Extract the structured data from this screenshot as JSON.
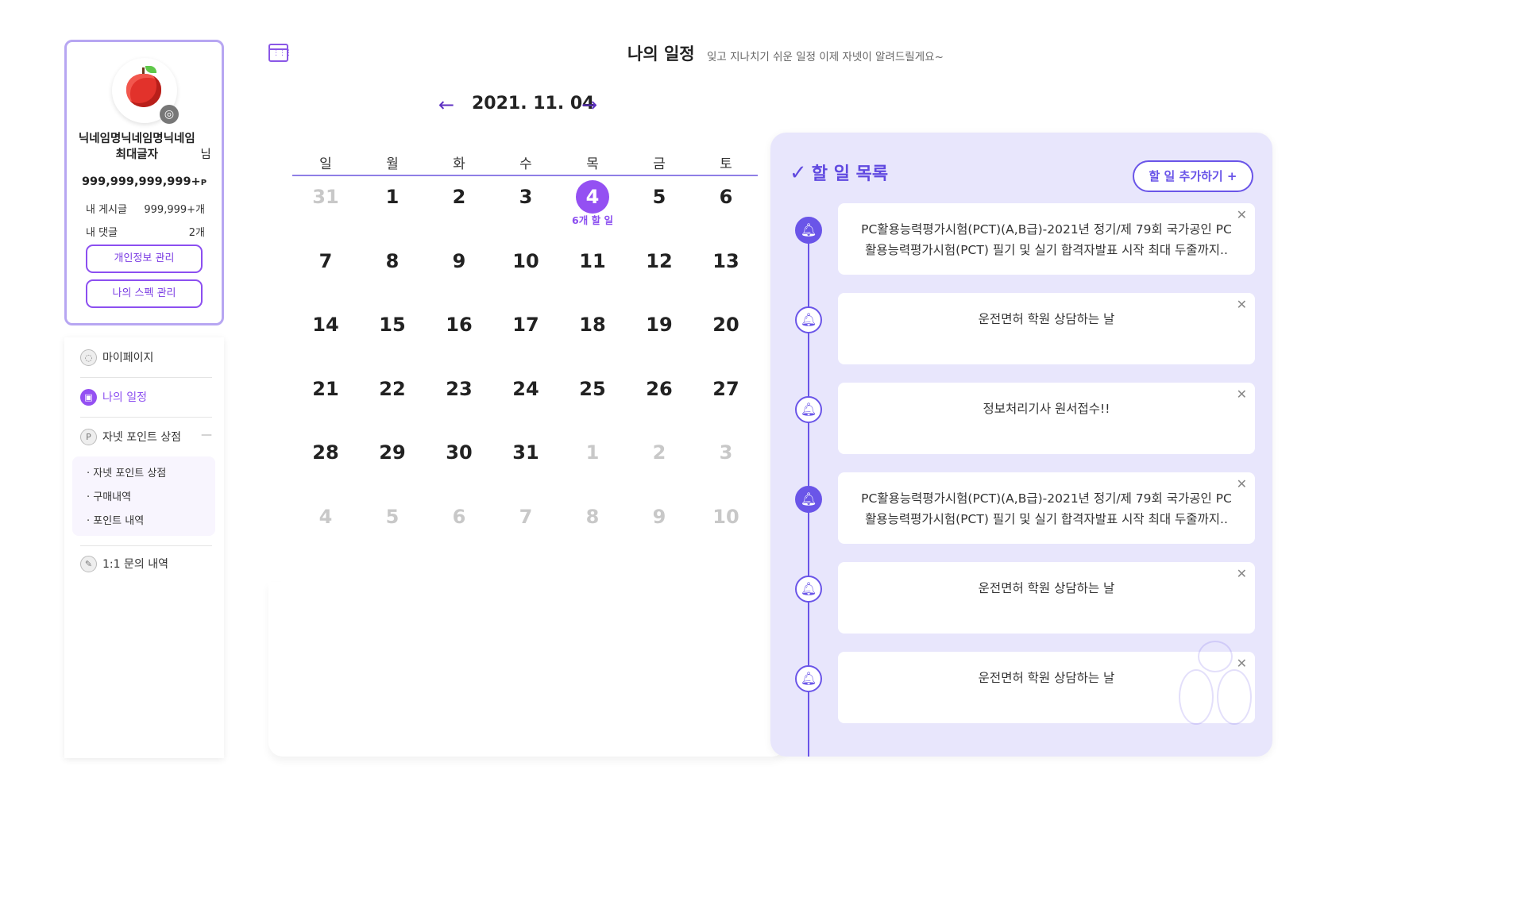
{
  "profile": {
    "nickname": "닉네임명닉네임명닉네임최대글자",
    "nickname_suffix": "님",
    "points": "999,999,999,999+",
    "points_unit": "P",
    "posts_label": "내 게시글",
    "posts_value": "999,999+개",
    "comments_label": "내 댓글",
    "comments_value": "2개",
    "btn_personal": "개인정보 관리",
    "btn_spec": "나의 스펙 관리"
  },
  "menu": {
    "mypage": "마이페이지",
    "schedule": "나의 일정",
    "point_shop": "자넷 포인트 상점",
    "sub": [
      "· 자넷 포인트 상점",
      "· 구매내역",
      "· 포인트 내역"
    ],
    "inquiry": "1:1 문의 내역"
  },
  "header": {
    "title": "나의 일정",
    "subtitle": "잊고 지나치기 쉬운 일정 이제 자넷이 알려드릴게요~",
    "date": "2021. 11. 04",
    "prev": "←",
    "next": "→"
  },
  "calendar": {
    "weekdays": [
      "일",
      "월",
      "화",
      "수",
      "목",
      "금",
      "토"
    ],
    "weeks": [
      [
        "31",
        "1",
        "2",
        "3",
        "4",
        "5",
        "6"
      ],
      [
        "7",
        "8",
        "9",
        "10",
        "11",
        "12",
        "13"
      ],
      [
        "14",
        "15",
        "16",
        "17",
        "18",
        "19",
        "20"
      ],
      [
        "21",
        "22",
        "23",
        "24",
        "25",
        "26",
        "27"
      ],
      [
        "28",
        "29",
        "30",
        "31",
        "1",
        "2",
        "3"
      ],
      [
        "4",
        "5",
        "6",
        "7",
        "8",
        "9",
        "10"
      ]
    ],
    "today_count": "6개 할 일"
  },
  "todo": {
    "title": "할 일 목록",
    "add_button": "할 일 추가하기 +",
    "items": [
      {
        "text": "PC활용능력평가시험(PCT)(A,B급)-2021년 정기/제 79회 국가공인 PC 활용능력평가시험(PCT) 필기 및 실기 합격자발표 시작 최대 두줄까지..",
        "active": true
      },
      {
        "text": "운전면허 학원 상담하는 날",
        "active": false
      },
      {
        "text": "정보처리기사 원서접수!!",
        "active": false
      },
      {
        "text": "PC활용능력평가시험(PCT)(A,B급)-2021년 정기/제 79회 국가공인 PC 활용능력평가시험(PCT) 필기 및 실기 합격자발표 시작 최대 두줄까지..",
        "active": true
      },
      {
        "text": "운전면허 학원 상담하는 날",
        "active": false
      },
      {
        "text": "운전면허 학원 상담하는 날",
        "active": false
      }
    ]
  },
  "colors": {
    "accent": "#9450f2",
    "panel": "#e8e6fc",
    "primary": "#6a55e8"
  }
}
